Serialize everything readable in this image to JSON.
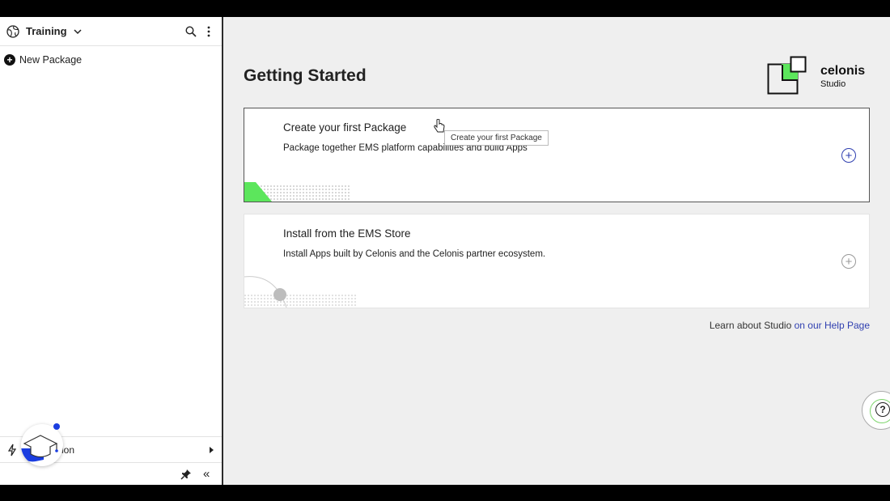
{
  "sidebar": {
    "workspace": "Training",
    "new_package": "New Package",
    "bottom_row_text": "ion"
  },
  "main": {
    "title": "Getting Started",
    "logo": {
      "name": "celonis",
      "sub": "Studio"
    },
    "cards": [
      {
        "title": "Create your first Package",
        "desc": "Package together EMS platform capabilities and build Apps"
      },
      {
        "title": "Install from the EMS Store",
        "desc": "Install Apps built by Celonis and the Celonis partner ecosystem."
      }
    ],
    "tooltip": "Create your first Package",
    "learn_prefix": "Learn about Studio",
    "learn_link": "on our Help Page"
  },
  "colors": {
    "accent": "#2f3fb0",
    "brand_green": "#5ce65c",
    "tutorial_blue": "#1a3de0"
  },
  "icons": [
    "globe-icon",
    "chevron-down-icon",
    "search-icon",
    "more-vertical-icon",
    "plus-circle-icon",
    "bolt-icon",
    "pin-icon",
    "double-chevron-left-icon",
    "graduation-cap-icon",
    "help-icon"
  ]
}
